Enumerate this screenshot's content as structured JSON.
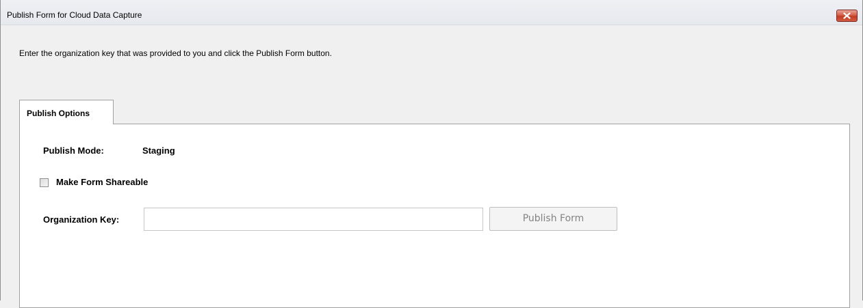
{
  "window": {
    "title": "Publish Form for Cloud Data Capture",
    "close_icon": "close-icon"
  },
  "instructions": "Enter the organization key that was provided to you and click the Publish Form button.",
  "tabs": [
    {
      "label": "Publish Options",
      "selected": true
    }
  ],
  "publish_options": {
    "mode_label": "Publish Mode:",
    "mode_value": "Staging",
    "shareable": {
      "label": "Make Form Shareable",
      "checked": false
    },
    "organization_key": {
      "label": "Organization Key:",
      "value": "",
      "placeholder": ""
    },
    "publish_button": {
      "label": "Publish Form",
      "enabled": false
    }
  },
  "colors": {
    "close_button": "#c94a36",
    "disabled_text": "#838383",
    "panel_border": "#a0a0a0"
  }
}
